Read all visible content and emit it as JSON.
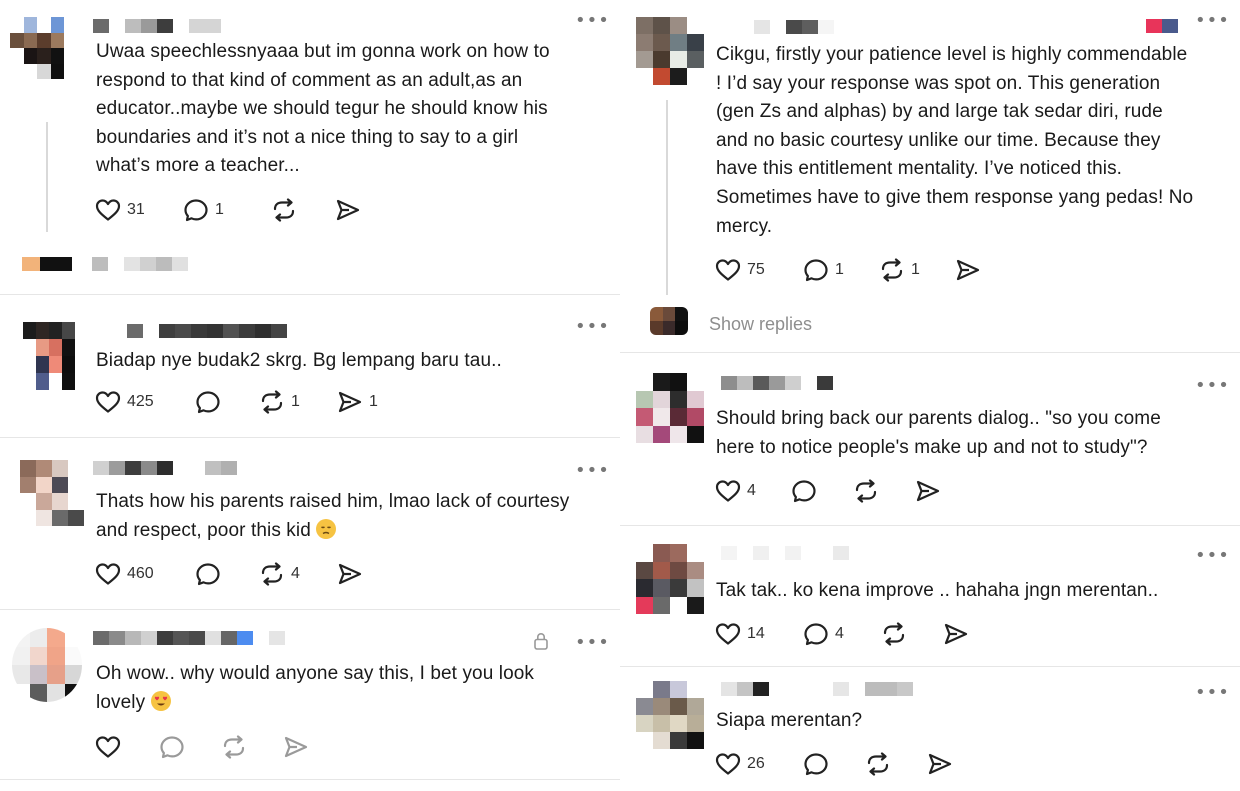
{
  "left_column": {
    "posts": [
      {
        "text_lines": [
          "Uwaa speechlessnyaaa but im gonna work on how to",
          "respond to that kind of comment as an adult,as an",
          "educator..maybe we should tegur he should know his",
          "boundaries and it’s not a nice thing to say to a girl",
          "what’s more a teacher..."
        ],
        "likes": "31",
        "replies": "1",
        "reposts": "",
        "shares": ""
      },
      {
        "text_lines": [
          "Biadap nye budak2 skrg. Bg lempang baru tau.."
        ],
        "likes": "425",
        "replies": "",
        "reposts": "1",
        "shares": "1"
      },
      {
        "text_lines": [
          "Thats how his parents raised him, lmao lack of courtesy",
          "and respect, poor this kid"
        ],
        "likes": "460",
        "replies": "",
        "reposts": "4",
        "shares": ""
      },
      {
        "text_lines": [
          "Oh wow.. why would anyone say this, I bet you look",
          "lovely"
        ],
        "likes": "",
        "replies": "",
        "reposts": "",
        "shares": ""
      }
    ]
  },
  "right_column": {
    "posts": [
      {
        "text_lines": [
          "Cikgu, firstly your patience level is highly commendable",
          "! I’d say your response was spot on. This generation",
          "(gen Zs and alphas) by and large tak sedar diri, rude",
          "and no basic courtesy unlike our time. Because they",
          "have this entitlement mentality. I’ve noticed this.",
          "Sometimes have to give them response yang pedas! No",
          "mercy."
        ],
        "likes": "75",
        "replies": "1",
        "reposts": "1",
        "shares": ""
      },
      {
        "text_lines": [
          "Should bring back our parents dialog.. \"so you come",
          "here to notice people's make up and not to study\"?"
        ],
        "likes": "4",
        "replies": "",
        "reposts": "",
        "shares": ""
      },
      {
        "text_lines": [
          "Tak tak.. ko kena improve .. hahaha jngn merentan.."
        ],
        "likes": "14",
        "replies": "4",
        "reposts": "",
        "shares": ""
      },
      {
        "text_lines": [
          "Siapa merentan?"
        ],
        "likes": "26",
        "replies": "",
        "reposts": "",
        "shares": ""
      }
    ],
    "show_replies": "Show replies"
  },
  "icons": {
    "like": "heart-icon",
    "reply": "comment-bubble-icon",
    "repost": "repost-arrows-icon",
    "share": "send-arrow-icon",
    "more": "more-dots-icon",
    "lock": "lock-icon",
    "emoji_sad": "disappointed-face-emoji",
    "emoji_love": "heart-eyes-emoji"
  },
  "more_label": "•••"
}
